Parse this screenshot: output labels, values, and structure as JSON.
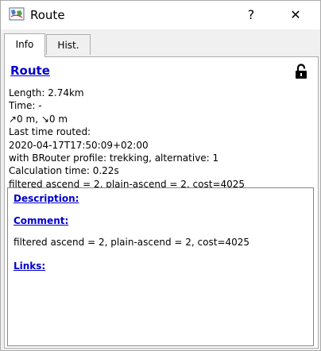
{
  "window": {
    "title": "Route",
    "icon": "map-icon",
    "help_label": "?",
    "close_label": "✕"
  },
  "tabs": [
    {
      "label": "Info",
      "active": true
    },
    {
      "label": "Hist.",
      "active": false
    }
  ],
  "info": {
    "heading": "Route",
    "lock_icon": "unlocked-padlock-icon",
    "length": "Length: 2.74km",
    "time": "Time: -",
    "elevation": "↗0 m, ↘0 m",
    "last_routed_label": "Last time routed:",
    "last_routed_value": "2020-04-17T17:50:09+02:00",
    "profile": "with BRouter profile: trekking, alternative: 1",
    "calc_time": "Calculation time: 0.22s",
    "filter_summary": "filtered ascend = 2, plain-ascend = 2, cost=4025"
  },
  "details": {
    "description_label": "Description:",
    "comment_label": "Comment:",
    "comment_text": "filtered ascend = 2, plain-ascend = 2, cost=4025",
    "links_label": "Links:"
  },
  "colors": {
    "link": "#0000cc",
    "client_bg": "#f0f0f0"
  }
}
